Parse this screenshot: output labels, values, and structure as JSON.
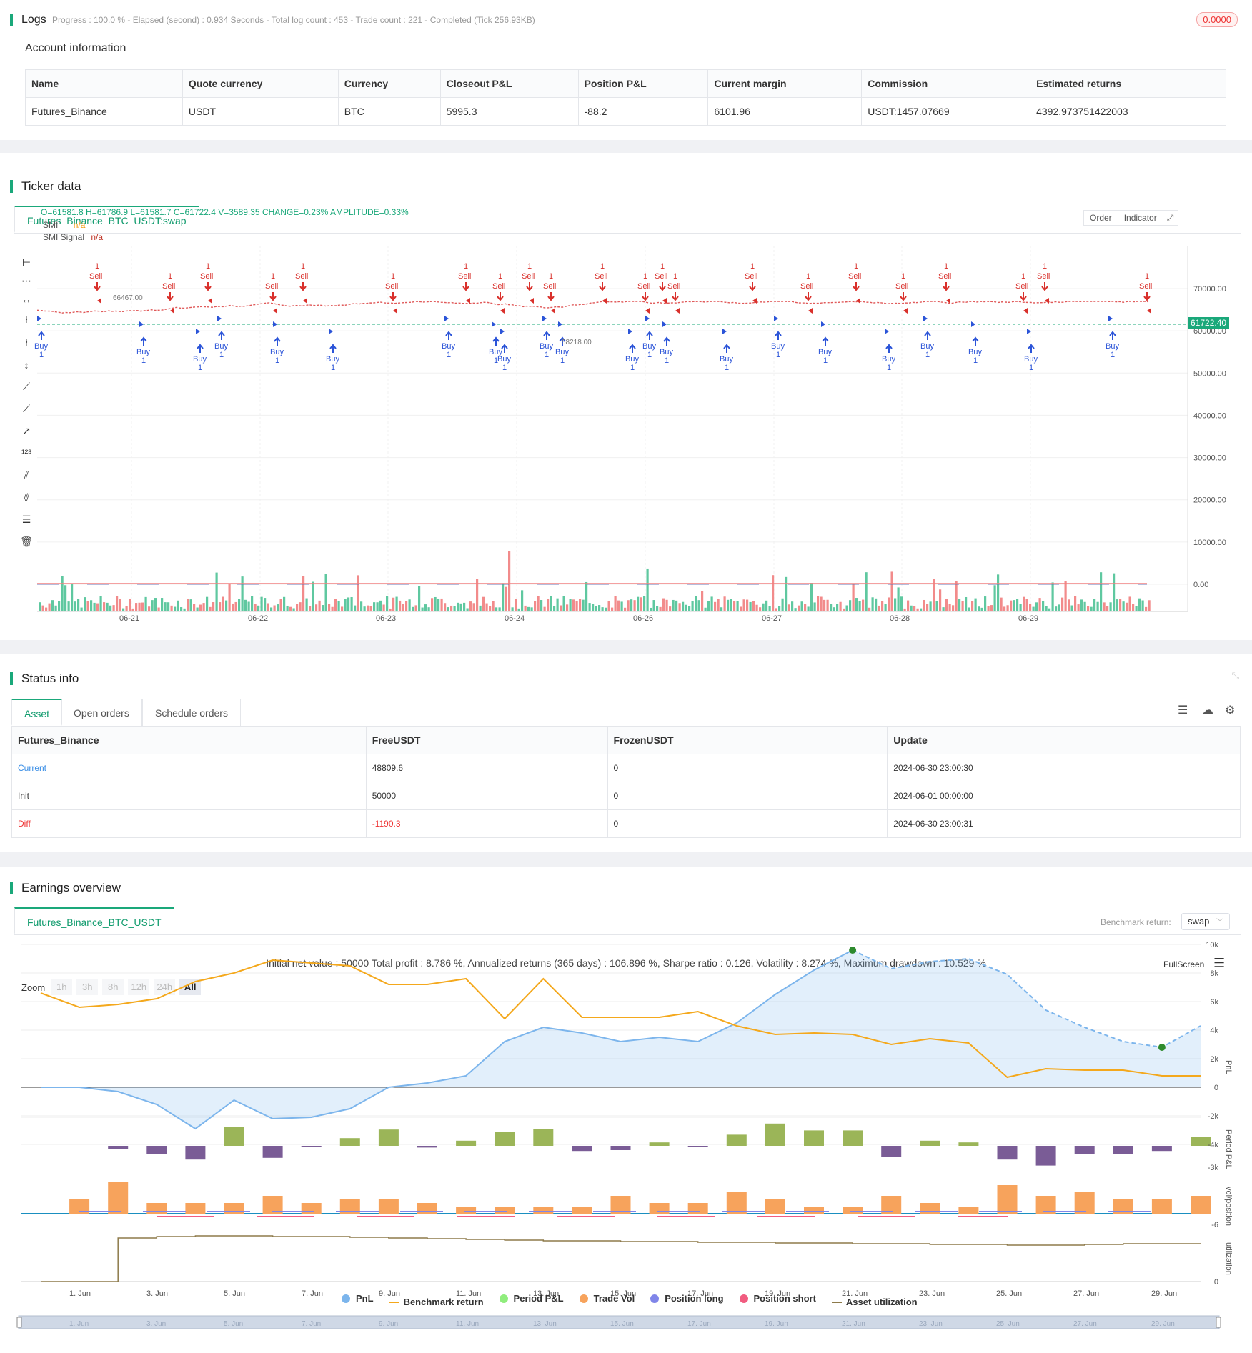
{
  "logs": {
    "title": "Logs",
    "progress": "Progress : 100.0 % - Elapsed (second) : 0.934  Seconds - Total log count : 453 - Trade count : 221 - Completed (Tick 256.93KB)",
    "badge": "0.0000"
  },
  "account": {
    "title": "Account information",
    "headers": [
      "Name",
      "Quote currency",
      "Currency",
      "Closeout P&L",
      "Position P&L",
      "Current margin",
      "Commission",
      "Estimated returns"
    ],
    "row": [
      "Futures_Binance",
      "USDT",
      "BTC",
      "5995.3",
      "-88.2",
      "6101.96",
      "USDT:1457.07669",
      "4392.973751422003"
    ]
  },
  "ticker": {
    "title": "Ticker data",
    "tab": "Futures_Binance_BTC_USDT:swap",
    "ohlc": "O=61581.8 H=61786.9 L=61581.7 C=61722.4 V=3589.35 CHANGE=0.23% AMPLITUDE=0.33%",
    "smi_label": "SMI",
    "smi_value": "n/a",
    "smi_signal_label": "SMI Signal",
    "smi_signal_value": "n/a",
    "btn_order": "Order",
    "btn_indicator": "Indicator",
    "price_tag": "61722.40",
    "high_label": "66467.00",
    "low_label": "58218.00",
    "y_ticks": [
      "70000.00",
      "60000.00",
      "50000.00",
      "40000.00",
      "30000.00",
      "20000.00",
      "10000.00",
      "0.00"
    ],
    "x_ticks": [
      "06-21",
      "06-22",
      "06-23",
      "06-24",
      "06-26",
      "06-27",
      "06-28",
      "06-29"
    ],
    "sell_label": "Sell",
    "buy_label": "Buy",
    "qty_label": "1"
  },
  "status": {
    "title": "Status info",
    "tabs": [
      "Asset",
      "Open orders",
      "Schedule orders"
    ],
    "headers": [
      "Futures_Binance",
      "FreeUSDT",
      "FrozenUSDT",
      "Update"
    ],
    "rows": [
      [
        "Current",
        "48809.6",
        "0",
        "2024-06-30 23:00:30"
      ],
      [
        "Init",
        "50000",
        "0",
        "2024-06-01 00:00:00"
      ],
      [
        "Diff",
        "-1190.3",
        "0",
        "2024-06-30 23:00:31"
      ]
    ]
  },
  "earnings": {
    "title": "Earnings overview",
    "tab": "Futures_Binance_BTC_USDT",
    "benchmark_label": "Benchmark return:",
    "benchmark_value": "swap",
    "summary": "Initial net value : 50000 Total profit : 8.786 %, Annualized returns (365 days) : 106.896 %, Sharpe ratio : 0.126, Volatility : 8.274 %, Maximum drawdown : 10.529 %",
    "fullscreen": "FullScreen",
    "zoom_label": "Zoom",
    "zoom_options": [
      "1h",
      "3h",
      "8h",
      "12h",
      "24h",
      "All"
    ],
    "pnl_ticks": [
      "10k",
      "8k",
      "6k",
      "4k",
      "2k",
      "0",
      "-2k",
      "-4k"
    ],
    "period_tick": "-3k",
    "vol_tick": "-6",
    "util_tick": "0",
    "axis_pnl": "PnL",
    "axis_period": "Period P&L",
    "axis_vol": "vol/position",
    "axis_util": "utilization",
    "x_ticks": [
      "1. Jun",
      "3. Jun",
      "5. Jun",
      "7. Jun",
      "9. Jun",
      "11. Jun",
      "13. Jun",
      "15. Jun",
      "17. Jun",
      "19. Jun",
      "21. Jun",
      "23. Jun",
      "25. Jun",
      "27. Jun",
      "29. Jun"
    ],
    "legend": [
      {
        "name": "PnL",
        "color": "#7cb5ec"
      },
      {
        "name": "Benchmark return",
        "color": "#f4a81c"
      },
      {
        "name": "Period P&L",
        "color": "#90ed7d"
      },
      {
        "name": "Trade Vol",
        "color": "#f7a35c"
      },
      {
        "name": "Position long",
        "color": "#8085e9"
      },
      {
        "name": "Position short",
        "color": "#f15c80"
      },
      {
        "name": "Asset utilization",
        "color": "#8d7a4a"
      }
    ]
  }
}
